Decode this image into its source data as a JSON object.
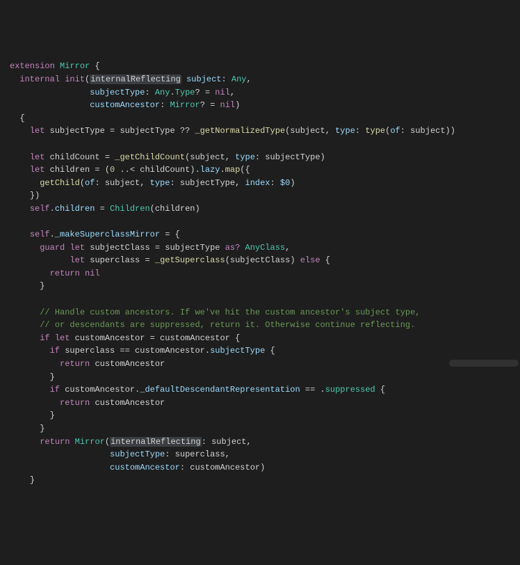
{
  "colors": {
    "bg": "#1e1e1e",
    "fg": "#d4d4d4",
    "keyword": "#c586c0",
    "type": "#4ec9b0",
    "func": "#dcdcaa",
    "param": "#9cdcfe",
    "comment": "#6a9955",
    "number": "#b5cea8",
    "highlight_bg": "#3a3d41"
  },
  "highlighted_identifier": "internalReflecting",
  "code_lines": [
    {
      "indent": 0,
      "tokens": [
        {
          "t": "kw-decl",
          "v": "extension"
        },
        {
          "t": "sp",
          "v": " "
        },
        {
          "t": "kw-type",
          "v": "Mirror"
        },
        {
          "t": "sp",
          "v": " "
        },
        {
          "t": "punct",
          "v": "{"
        }
      ]
    },
    {
      "indent": 1,
      "tokens": [
        {
          "t": "kw-decl",
          "v": "internal"
        },
        {
          "t": "sp",
          "v": " "
        },
        {
          "t": "kw-decl",
          "v": "init"
        },
        {
          "t": "punct",
          "v": "("
        },
        {
          "t": "highlight",
          "v": "internalReflecting"
        },
        {
          "t": "sp",
          "v": " "
        },
        {
          "t": "param",
          "v": "subject"
        },
        {
          "t": "punct",
          "v": ": "
        },
        {
          "t": "kw-type",
          "v": "Any"
        },
        {
          "t": "punct",
          "v": ","
        }
      ]
    },
    {
      "indent": 1,
      "tokens": [
        {
          "t": "pad",
          "v": "              "
        },
        {
          "t": "param",
          "v": "subjectType"
        },
        {
          "t": "punct",
          "v": ": "
        },
        {
          "t": "kw-type",
          "v": "Any"
        },
        {
          "t": "punct",
          "v": "."
        },
        {
          "t": "kw-type",
          "v": "Type"
        },
        {
          "t": "punct",
          "v": "? = "
        },
        {
          "t": "lit-nil",
          "v": "nil"
        },
        {
          "t": "punct",
          "v": ","
        }
      ]
    },
    {
      "indent": 1,
      "tokens": [
        {
          "t": "pad",
          "v": "              "
        },
        {
          "t": "param",
          "v": "customAncestor"
        },
        {
          "t": "punct",
          "v": ": "
        },
        {
          "t": "kw-type",
          "v": "Mirror"
        },
        {
          "t": "punct",
          "v": "? = "
        },
        {
          "t": "lit-nil",
          "v": "nil"
        },
        {
          "t": "punct",
          "v": ")"
        }
      ]
    },
    {
      "indent": 1,
      "tokens": [
        {
          "t": "punct",
          "v": "{"
        }
      ]
    },
    {
      "indent": 2,
      "tokens": [
        {
          "t": "kw-decl",
          "v": "let"
        },
        {
          "t": "sp",
          "v": " "
        },
        {
          "t": "ident",
          "v": "subjectType = subjectType ?? "
        },
        {
          "t": "func",
          "v": "_getNormalizedType"
        },
        {
          "t": "punct",
          "v": "(subject, "
        },
        {
          "t": "param",
          "v": "type"
        },
        {
          "t": "punct",
          "v": ": "
        },
        {
          "t": "func",
          "v": "type"
        },
        {
          "t": "punct",
          "v": "("
        },
        {
          "t": "param",
          "v": "of"
        },
        {
          "t": "punct",
          "v": ": subject))"
        }
      ]
    },
    {
      "indent": 0,
      "tokens": [
        {
          "t": "sp",
          "v": " "
        }
      ]
    },
    {
      "indent": 2,
      "tokens": [
        {
          "t": "kw-decl",
          "v": "let"
        },
        {
          "t": "sp",
          "v": " "
        },
        {
          "t": "ident",
          "v": "childCount = "
        },
        {
          "t": "func",
          "v": "_getChildCount"
        },
        {
          "t": "punct",
          "v": "(subject, "
        },
        {
          "t": "param",
          "v": "type"
        },
        {
          "t": "punct",
          "v": ": subjectType)"
        }
      ]
    },
    {
      "indent": 2,
      "tokens": [
        {
          "t": "kw-decl",
          "v": "let"
        },
        {
          "t": "sp",
          "v": " "
        },
        {
          "t": "ident",
          "v": "children = ("
        },
        {
          "t": "num",
          "v": "0"
        },
        {
          "t": "ident",
          "v": " ..< childCount)."
        },
        {
          "t": "prop",
          "v": "lazy"
        },
        {
          "t": "ident",
          "v": "."
        },
        {
          "t": "func",
          "v": "map"
        },
        {
          "t": "punct",
          "v": "({"
        }
      ]
    },
    {
      "indent": 3,
      "tokens": [
        {
          "t": "func",
          "v": "getChild"
        },
        {
          "t": "punct",
          "v": "("
        },
        {
          "t": "param",
          "v": "of"
        },
        {
          "t": "punct",
          "v": ": subject, "
        },
        {
          "t": "param",
          "v": "type"
        },
        {
          "t": "punct",
          "v": ": subjectType, "
        },
        {
          "t": "param",
          "v": "index"
        },
        {
          "t": "punct",
          "v": ": "
        },
        {
          "t": "dollar",
          "v": "$0"
        },
        {
          "t": "punct",
          "v": ")"
        }
      ]
    },
    {
      "indent": 2,
      "tokens": [
        {
          "t": "punct",
          "v": "})"
        }
      ]
    },
    {
      "indent": 2,
      "tokens": [
        {
          "t": "kw-self",
          "v": "self"
        },
        {
          "t": "punct",
          "v": "."
        },
        {
          "t": "prop",
          "v": "children"
        },
        {
          "t": "punct",
          "v": " = "
        },
        {
          "t": "kw-type",
          "v": "Children"
        },
        {
          "t": "punct",
          "v": "(children)"
        }
      ]
    },
    {
      "indent": 0,
      "tokens": [
        {
          "t": "sp",
          "v": " "
        }
      ]
    },
    {
      "indent": 2,
      "tokens": [
        {
          "t": "kw-self",
          "v": "self"
        },
        {
          "t": "punct",
          "v": "."
        },
        {
          "t": "prop",
          "v": "_makeSuperclassMirror"
        },
        {
          "t": "punct",
          "v": " = {"
        }
      ]
    },
    {
      "indent": 3,
      "tokens": [
        {
          "t": "kw-decl",
          "v": "guard"
        },
        {
          "t": "sp",
          "v": " "
        },
        {
          "t": "kw-decl",
          "v": "let"
        },
        {
          "t": "sp",
          "v": " "
        },
        {
          "t": "ident",
          "v": "subjectClass = subjectType "
        },
        {
          "t": "kw-decl",
          "v": "as?"
        },
        {
          "t": "sp",
          "v": " "
        },
        {
          "t": "kw-type",
          "v": "AnyClass"
        },
        {
          "t": "punct",
          "v": ","
        }
      ]
    },
    {
      "indent": 3,
      "tokens": [
        {
          "t": "pad",
          "v": "      "
        },
        {
          "t": "kw-decl",
          "v": "let"
        },
        {
          "t": "sp",
          "v": " "
        },
        {
          "t": "ident",
          "v": "superclass = "
        },
        {
          "t": "func",
          "v": "_getSuperclass"
        },
        {
          "t": "punct",
          "v": "(subjectClass) "
        },
        {
          "t": "kw-decl",
          "v": "else"
        },
        {
          "t": "punct",
          "v": " {"
        }
      ]
    },
    {
      "indent": 4,
      "tokens": [
        {
          "t": "kw-decl",
          "v": "return"
        },
        {
          "t": "sp",
          "v": " "
        },
        {
          "t": "lit-nil",
          "v": "nil"
        }
      ]
    },
    {
      "indent": 3,
      "tokens": [
        {
          "t": "punct",
          "v": "}"
        }
      ]
    },
    {
      "indent": 0,
      "tokens": [
        {
          "t": "sp",
          "v": " "
        }
      ]
    },
    {
      "indent": 3,
      "tokens": [
        {
          "t": "comment",
          "v": "// Handle custom ancestors. If we've hit the custom ancestor's subject type,"
        }
      ]
    },
    {
      "indent": 3,
      "tokens": [
        {
          "t": "comment",
          "v": "// or descendants are suppressed, return it. Otherwise continue reflecting."
        }
      ]
    },
    {
      "indent": 3,
      "tokens": [
        {
          "t": "kw-decl",
          "v": "if"
        },
        {
          "t": "sp",
          "v": " "
        },
        {
          "t": "kw-decl",
          "v": "let"
        },
        {
          "t": "sp",
          "v": " "
        },
        {
          "t": "ident",
          "v": "customAncestor = customAncestor {"
        }
      ]
    },
    {
      "indent": 4,
      "tokens": [
        {
          "t": "kw-decl",
          "v": "if"
        },
        {
          "t": "sp",
          "v": " "
        },
        {
          "t": "ident",
          "v": "superclass == customAncestor."
        },
        {
          "t": "prop",
          "v": "subjectType"
        },
        {
          "t": "punct",
          "v": " {"
        }
      ]
    },
    {
      "indent": 5,
      "tokens": [
        {
          "t": "kw-decl",
          "v": "return"
        },
        {
          "t": "sp",
          "v": " "
        },
        {
          "t": "ident",
          "v": "customAncestor"
        }
      ]
    },
    {
      "indent": 4,
      "tokens": [
        {
          "t": "punct",
          "v": "}"
        }
      ]
    },
    {
      "indent": 4,
      "tokens": [
        {
          "t": "kw-decl",
          "v": "if"
        },
        {
          "t": "sp",
          "v": " "
        },
        {
          "t": "ident",
          "v": "customAncestor."
        },
        {
          "t": "prop",
          "v": "_defaultDescendantRepresentation"
        },
        {
          "t": "ident",
          "v": " == ."
        },
        {
          "t": "enum",
          "v": "suppressed"
        },
        {
          "t": "punct",
          "v": " {"
        }
      ]
    },
    {
      "indent": 5,
      "tokens": [
        {
          "t": "kw-decl",
          "v": "return"
        },
        {
          "t": "sp",
          "v": " "
        },
        {
          "t": "ident",
          "v": "customAncestor"
        }
      ]
    },
    {
      "indent": 4,
      "tokens": [
        {
          "t": "punct",
          "v": "}"
        }
      ]
    },
    {
      "indent": 3,
      "tokens": [
        {
          "t": "punct",
          "v": "}"
        }
      ]
    },
    {
      "indent": 3,
      "tokens": [
        {
          "t": "kw-decl",
          "v": "return"
        },
        {
          "t": "sp",
          "v": " "
        },
        {
          "t": "kw-type",
          "v": "Mirror"
        },
        {
          "t": "punct",
          "v": "("
        },
        {
          "t": "highlight",
          "v": "internalReflecting"
        },
        {
          "t": "punct",
          "v": ": subject,"
        }
      ]
    },
    {
      "indent": 3,
      "tokens": [
        {
          "t": "pad",
          "v": "              "
        },
        {
          "t": "param",
          "v": "subjectType"
        },
        {
          "t": "punct",
          "v": ": superclass,"
        }
      ]
    },
    {
      "indent": 3,
      "tokens": [
        {
          "t": "pad",
          "v": "              "
        },
        {
          "t": "param",
          "v": "customAncestor"
        },
        {
          "t": "punct",
          "v": ": customAncestor)"
        }
      ]
    },
    {
      "indent": 2,
      "tokens": [
        {
          "t": "punct",
          "v": "}"
        }
      ]
    }
  ]
}
